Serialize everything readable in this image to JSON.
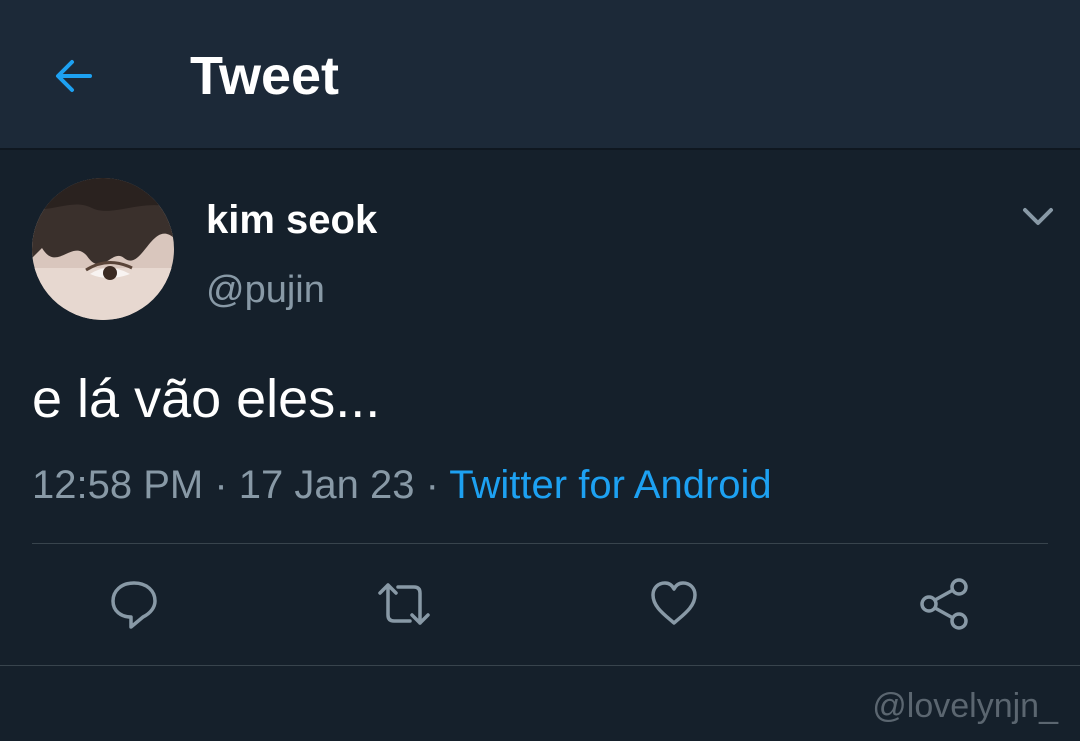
{
  "header": {
    "title": "Tweet",
    "back_icon": "arrow-left-icon"
  },
  "tweet": {
    "author": {
      "display_name": "kim seok",
      "handle": "@pujin"
    },
    "text": "e lá vão eles...",
    "time": "12:58 PM",
    "separator": " · ",
    "date": "17 Jan 23",
    "source": "Twitter for Android",
    "more_icon": "chevron-down-icon"
  },
  "actions": [
    {
      "name": "reply",
      "icon": "reply-icon"
    },
    {
      "name": "retweet",
      "icon": "retweet-icon"
    },
    {
      "name": "like",
      "icon": "heart-icon"
    },
    {
      "name": "share",
      "icon": "share-icon"
    }
  ],
  "watermark": "@lovelynjn_",
  "colors": {
    "background": "#15202b",
    "header": "#1c2938",
    "accent": "#1da1f2",
    "secondary_text": "#8899a6",
    "divider": "#38444d"
  }
}
